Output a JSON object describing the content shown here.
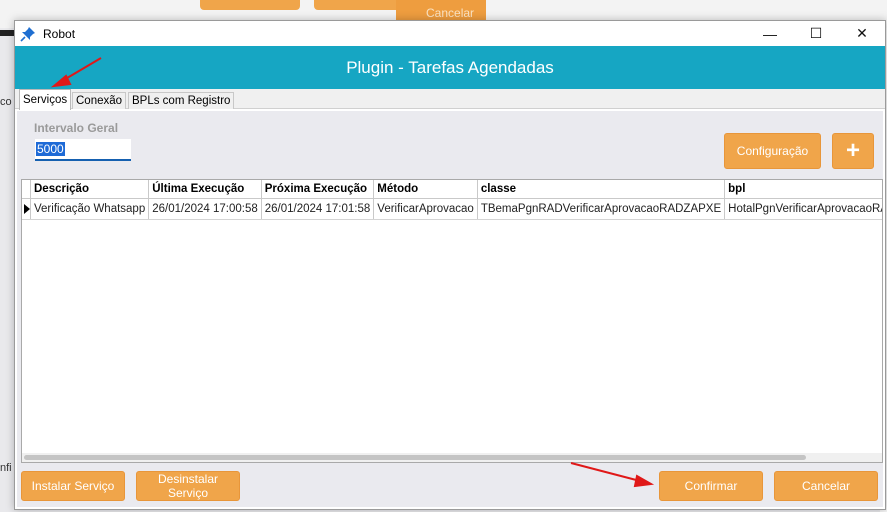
{
  "background": {
    "cancel_label": "Cancelar",
    "left_text_1": "co",
    "left_text_2": "nfi"
  },
  "window": {
    "title": "Robot",
    "icon": "pin-icon",
    "controls": {
      "minimize": "—",
      "maximize": "☐",
      "close": "✕"
    }
  },
  "banner": {
    "title": "Plugin - Tarefas Agendadas"
  },
  "tabs": [
    {
      "label": "Serviços",
      "active": true
    },
    {
      "label": "Conexão",
      "active": false
    },
    {
      "label": "BPLs com Registro",
      "active": false
    }
  ],
  "intervalo": {
    "label": "Intervalo Geral",
    "value": "5000"
  },
  "buttons": {
    "configuracao": "Configuração",
    "add": "+",
    "instalar": "Instalar Serviço",
    "desinstalar": "Desinstalar Serviço",
    "confirmar": "Confirmar",
    "cancelar": "Cancelar"
  },
  "grid": {
    "columns": [
      "Descrição",
      "Última Execução",
      "Próxima Execução",
      "Método",
      "classe",
      "bpl"
    ],
    "rows": [
      [
        "Verificação Whatsapp",
        "26/01/2024 17:00:58",
        "26/01/2024 17:01:58",
        "VerificarAprovacao",
        "TBemaPgnRADVerificarAprovacaoRADZAPXE",
        "HotalPgnVerificarAprovacaoRADZAPXE.b"
      ]
    ]
  },
  "colors": {
    "accent_banner": "#16a6c3",
    "button_orange": "#f0a54a",
    "annotation_arrow": "#e01818",
    "selected_cell": "#1976a8"
  }
}
